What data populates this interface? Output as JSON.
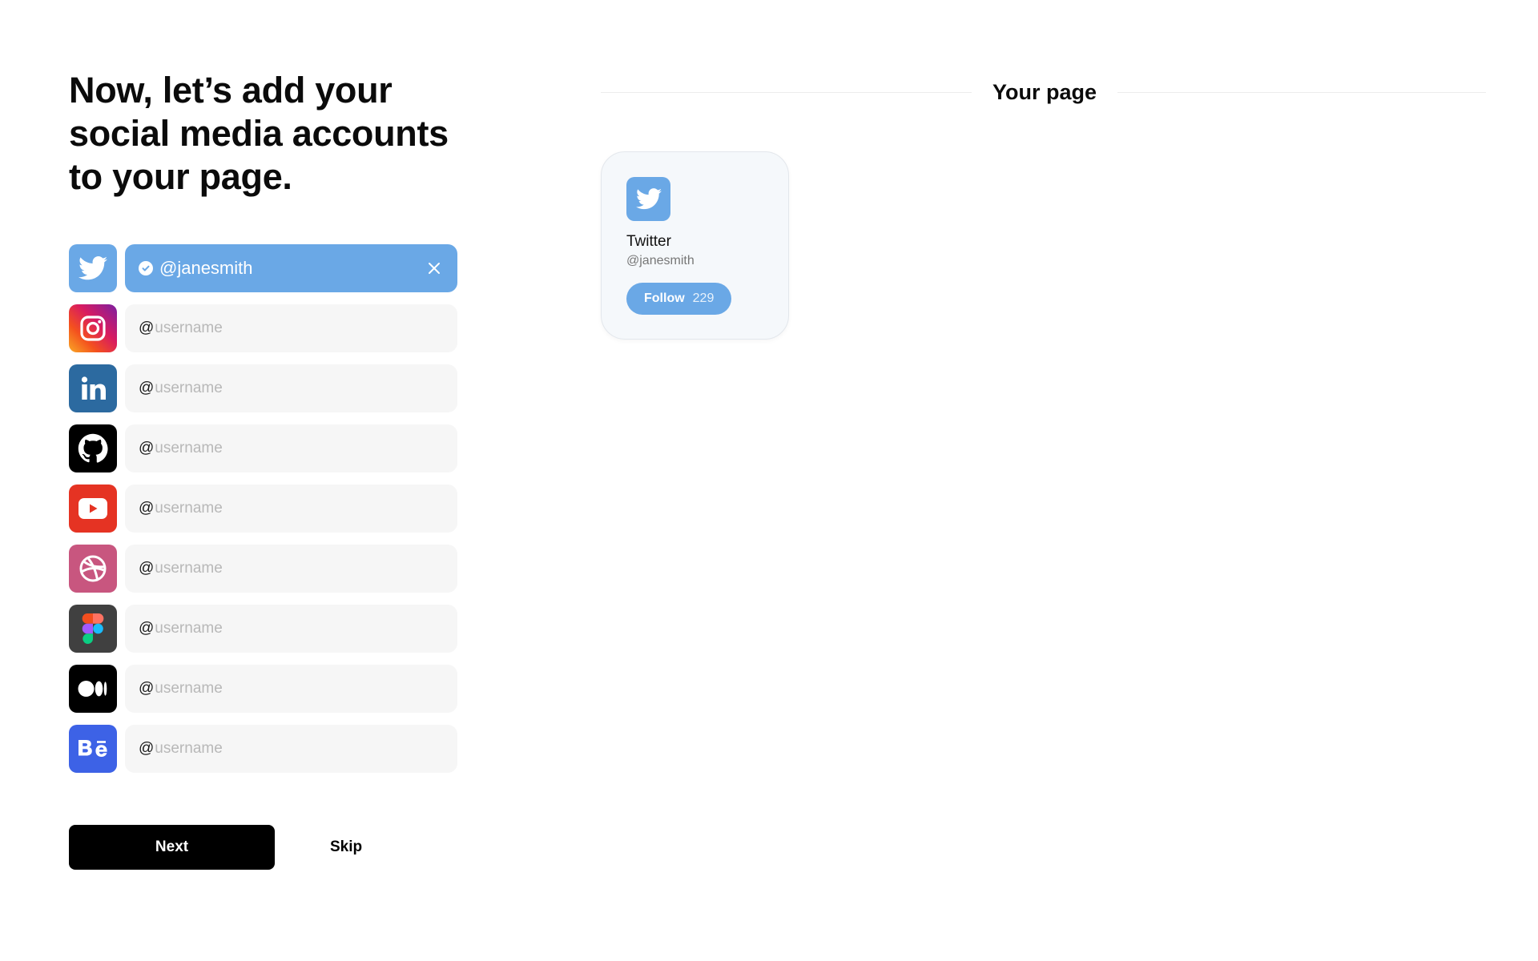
{
  "headline": "Now, let’s add your social media accounts to your page.",
  "accounts": [
    {
      "platform": "Twitter",
      "icon": "twitter-icon",
      "prefix": "@",
      "value": "@janesmith",
      "connected": true,
      "color": "#6aa8e6"
    },
    {
      "platform": "Instagram",
      "icon": "instagram-icon",
      "prefix": "@",
      "placeholder": "username",
      "color": "#e1306c"
    },
    {
      "platform": "LinkedIn",
      "icon": "linkedin-icon",
      "prefix": "@",
      "placeholder": "username",
      "color": "#2c6aa0"
    },
    {
      "platform": "GitHub",
      "icon": "github-icon",
      "prefix": "@",
      "placeholder": "username",
      "color": "#000000"
    },
    {
      "platform": "YouTube",
      "icon": "youtube-icon",
      "prefix": "@",
      "placeholder": "username",
      "color": "#e53323"
    },
    {
      "platform": "Dribbble",
      "icon": "dribbble-icon",
      "prefix": "@",
      "placeholder": "username",
      "color": "#c8567f"
    },
    {
      "platform": "Figma",
      "icon": "figma-icon",
      "prefix": "@",
      "placeholder": "username",
      "color": "#404040"
    },
    {
      "platform": "Medium",
      "icon": "medium-icon",
      "prefix": "@",
      "placeholder": "username",
      "color": "#000000"
    },
    {
      "platform": "Behance",
      "icon": "behance-icon",
      "prefix": "@",
      "placeholder": "username",
      "color": "#3d62e6"
    }
  ],
  "actions": {
    "next_label": "Next",
    "skip_label": "Skip"
  },
  "preview": {
    "title": "Your page",
    "card": {
      "name": "Twitter",
      "handle": "@janesmith",
      "follow_label": "Follow",
      "follow_count": "229",
      "icon": "twitter-icon"
    }
  }
}
